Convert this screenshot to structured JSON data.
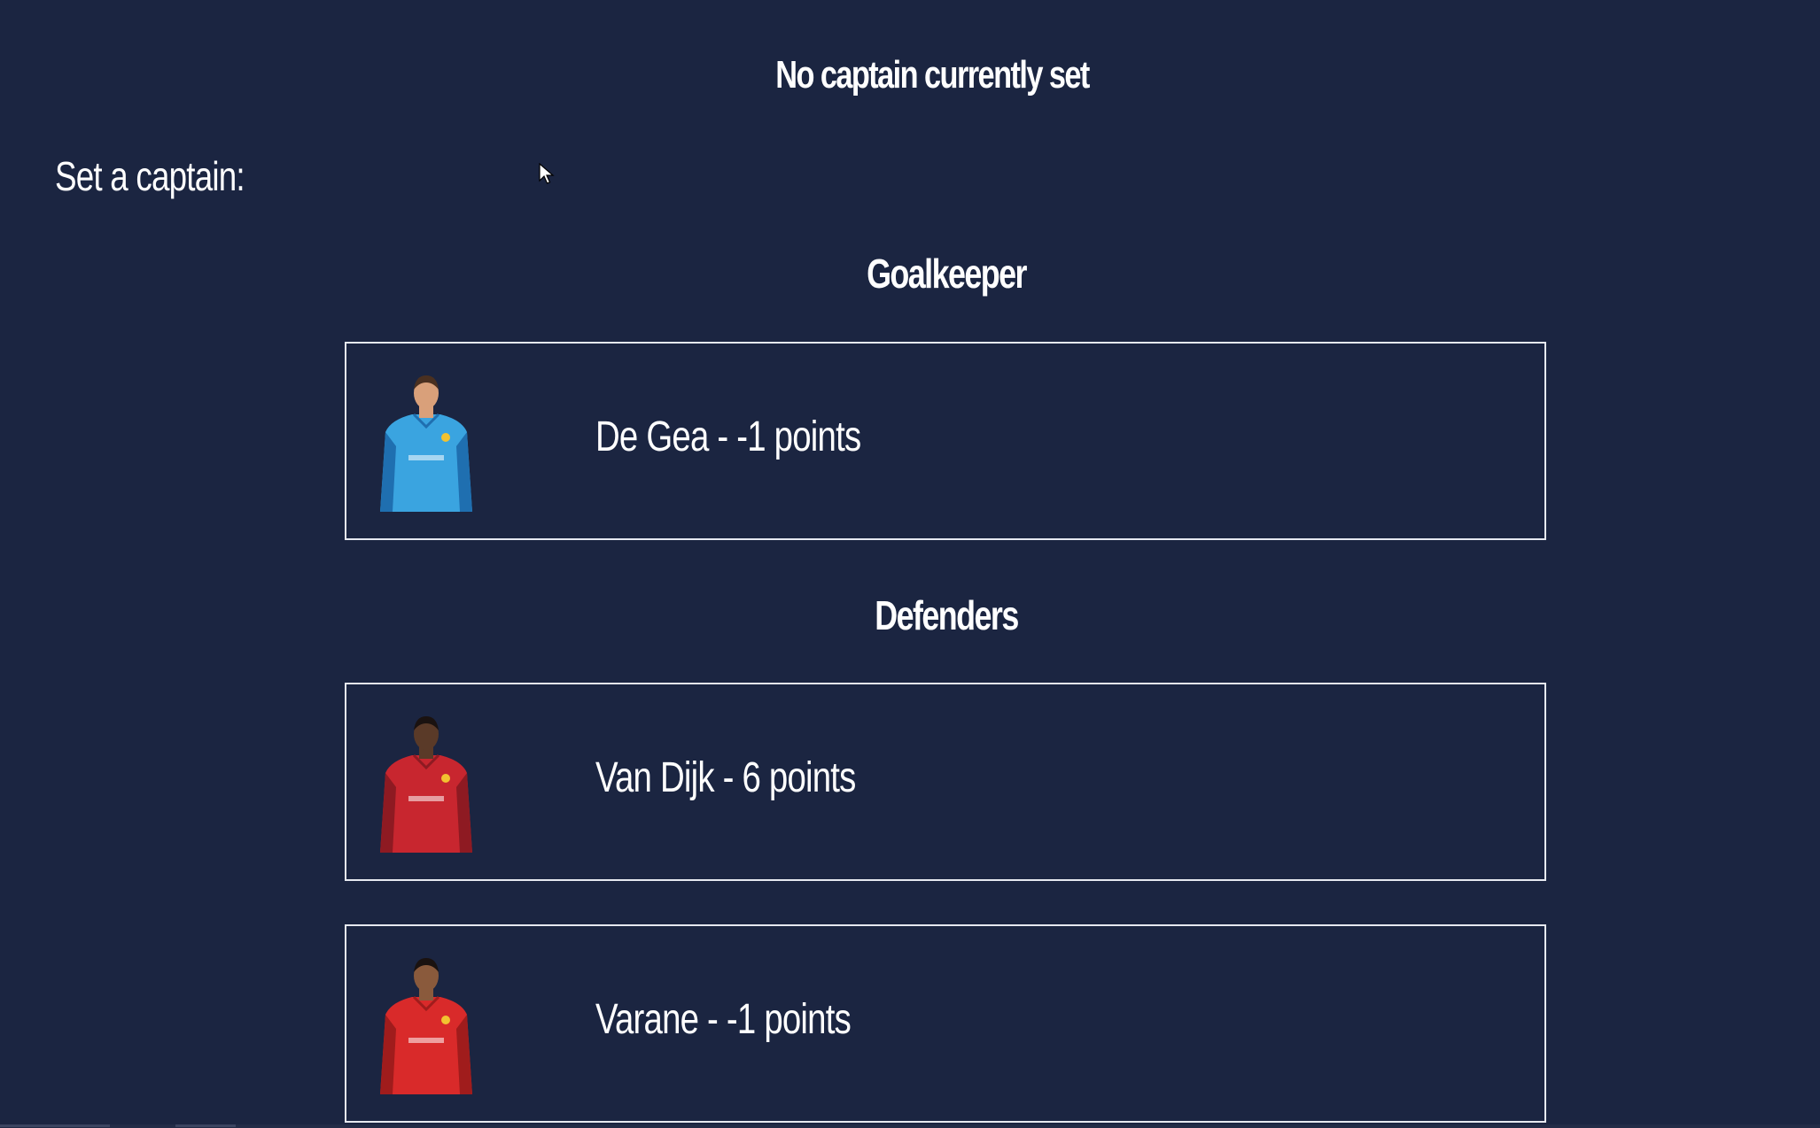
{
  "status": {
    "title": "No captain currently set"
  },
  "set_captain": {
    "label": "Set a captain:"
  },
  "sections": [
    {
      "heading": "Goalkeeper",
      "players": [
        {
          "label": "De Gea - -1 points",
          "kit_color": "#3aa4e0",
          "kit_dark": "#1f6fb0",
          "skin": "#d9a07a",
          "hair": "#4a3020"
        }
      ]
    },
    {
      "heading": "Defenders",
      "players": [
        {
          "label": "Van Dijk - 6 points",
          "kit_color": "#c8262f",
          "kit_dark": "#8e1a22",
          "skin": "#5a3a28",
          "hair": "#1a1210"
        },
        {
          "label": "Varane - -1 points",
          "kit_color": "#d92a2a",
          "kit_dark": "#a01c1c",
          "skin": "#8a5a3c",
          "hair": "#1a1210"
        }
      ]
    }
  ],
  "colors": {
    "background": "#1b2541",
    "card_border": "#e6e9f0",
    "text": "#ffffff"
  }
}
